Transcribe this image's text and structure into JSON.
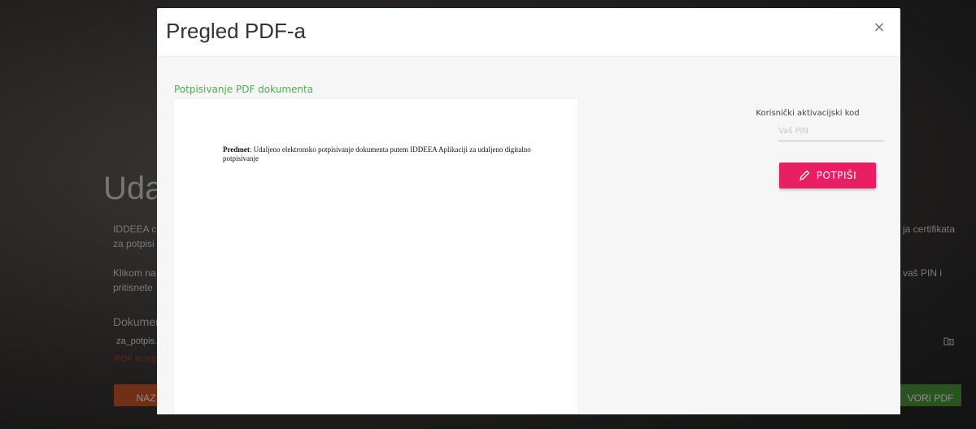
{
  "background": {
    "title": "Uda",
    "paragraph1_line1": "IDDEEA c",
    "paragraph1_line2": "za potpisi",
    "paragraph1_right": "ja certifikata",
    "paragraph2_line1": "Klikom na",
    "paragraph2_line2": "pritisnete",
    "paragraph2_right": "vaš PIN i",
    "document_label": "Dokumer",
    "file_name": "za_potpis.",
    "error_text": "PDF to sig",
    "left_button": "NAZ",
    "right_button": "VORI PDF",
    "right_icon": "folder-icon"
  },
  "modal": {
    "title": "Pregled PDF-a",
    "close_label": "×",
    "section_label": "Potpisivanje PDF dokumenta",
    "pdf": {
      "subject_label": "Predmet",
      "subject_text": ": Udaljeno elektronsko potpisivanje dokumenta putem IDDEEA Aplikaciji za udaljeno digitalno potpisivanje"
    },
    "pin_label": "Korisnički aktivacijski kod",
    "pin_placeholder": "Vaš PIN",
    "pin_value": "",
    "sign_button": "POTPIŠI",
    "sign_icon": "pencil-icon",
    "colors": {
      "accent_green": "#4caf50",
      "sign_pink": "#e91e63"
    }
  }
}
